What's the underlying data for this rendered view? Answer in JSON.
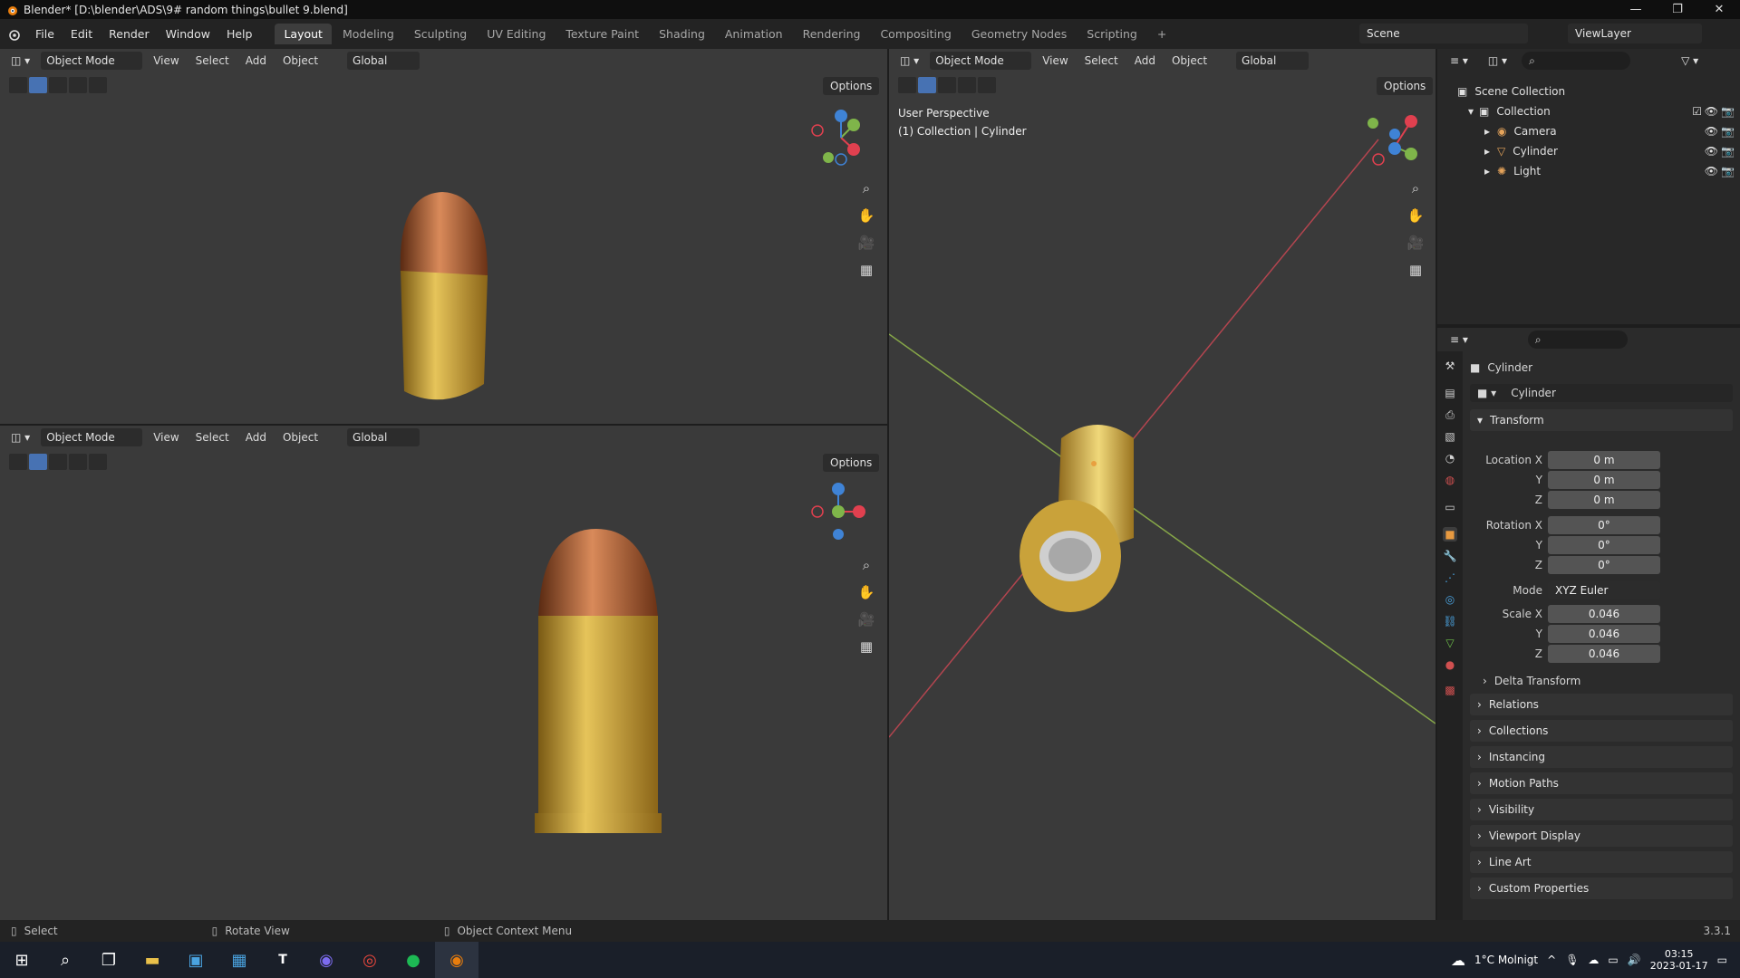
{
  "window": {
    "title": "Blender* [D:\\blender\\ADS\\9# random things\\bullet 9.blend]",
    "controls": [
      "—",
      "❐",
      "✕"
    ]
  },
  "menubar": {
    "menus": [
      "File",
      "Edit",
      "Render",
      "Window",
      "Help"
    ],
    "workspaces": [
      "Layout",
      "Modeling",
      "Sculpting",
      "UV Editing",
      "Texture Paint",
      "Shading",
      "Animation",
      "Rendering",
      "Compositing",
      "Geometry Nodes",
      "Scripting"
    ],
    "active_workspace": "Layout",
    "add_workspace": "+",
    "scene": "Scene",
    "view_layer": "ViewLayer"
  },
  "viewport_header": {
    "mode": "Object Mode",
    "menus": [
      "View",
      "Select",
      "Add",
      "Object"
    ],
    "orientation": "Global",
    "options": "Options"
  },
  "viewport_main": {
    "perspective": "User Perspective",
    "context": "(1) Collection | Cylinder"
  },
  "outliner": {
    "root": "Scene Collection",
    "collection": "Collection",
    "objects": [
      {
        "name": "Camera",
        "icon": "camera-icon"
      },
      {
        "name": "Cylinder",
        "icon": "mesh-icon"
      },
      {
        "name": "Light",
        "icon": "light-icon"
      }
    ]
  },
  "properties": {
    "object_name": "Cylinder",
    "data_name": "Cylinder",
    "transform_label": "Transform",
    "location": {
      "label_x": "Location X",
      "label_y": "Y",
      "label_z": "Z",
      "x": "0 m",
      "y": "0 m",
      "z": "0 m"
    },
    "rotation": {
      "label_x": "Rotation X",
      "label_y": "Y",
      "label_z": "Z",
      "x": "0°",
      "y": "0°",
      "z": "0°"
    },
    "mode": {
      "label": "Mode",
      "value": "XYZ Euler"
    },
    "scale": {
      "label_x": "Scale X",
      "label_y": "Y",
      "label_z": "Z",
      "x": "0.046",
      "y": "0.046",
      "z": "0.046"
    },
    "delta_transform": "Delta Transform",
    "panels": [
      "Relations",
      "Collections",
      "Instancing",
      "Motion Paths",
      "Visibility",
      "Viewport Display",
      "Line Art",
      "Custom Properties"
    ]
  },
  "statusbar": {
    "select": "Select",
    "rotate": "Rotate View",
    "context_menu": "Object Context Menu",
    "version": "3.3.1"
  },
  "taskbar": {
    "weather": "1°C  Molnigt",
    "time": "03:15",
    "date": "2023-01-17"
  },
  "colors": {
    "accent": "#4772b3",
    "brass": "#c9a23a",
    "copper": "#9a4f2a",
    "axis_x": "#e0404f",
    "axis_y": "#7fb54a",
    "axis_z": "#3f83d6"
  }
}
